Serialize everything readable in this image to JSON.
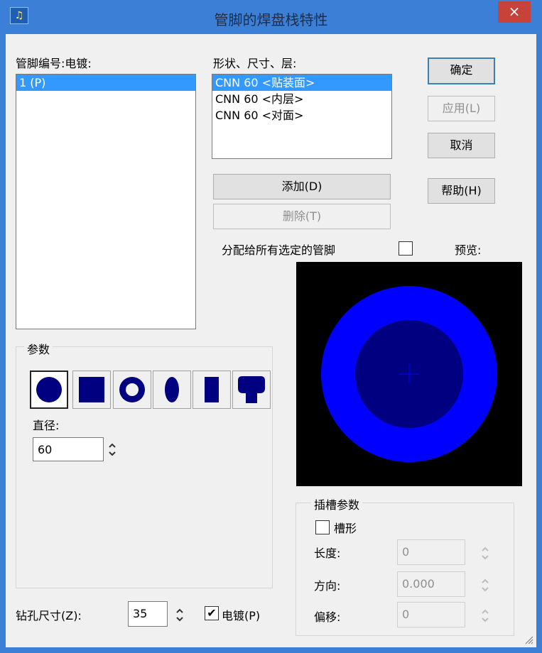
{
  "window": {
    "title": "管脚的焊盘栈特性",
    "icon": "app-icon",
    "close_symbol": "×"
  },
  "left": {
    "label": "管脚编号:电镀:",
    "items": [
      {
        "label": "1 (P)",
        "selected": true
      }
    ]
  },
  "layers": {
    "label": "形状、尺寸、层:",
    "items": [
      {
        "label": "CNN 60 <贴装面>",
        "selected": true
      },
      {
        "label": "CNN 60 <内层>",
        "selected": false
      },
      {
        "label": "CNN 60 <对面>",
        "selected": false
      }
    ]
  },
  "buttons": {
    "ok": "确定",
    "apply": "应用(L)",
    "cancel": "取消",
    "help": "帮助(H)",
    "add": "添加(D)",
    "delete": "删除(T)"
  },
  "assign": {
    "label": "分配给所有选定的管脚",
    "checked": false
  },
  "preview": {
    "label": "预览:",
    "colors": {
      "outer": "#0000ff",
      "inner": "#000080",
      "cross": "#0000ff"
    }
  },
  "params": {
    "title": "参数",
    "shapes": [
      "round",
      "square",
      "annular",
      "oval",
      "rectangle",
      "custom"
    ],
    "selected_shape": "round",
    "diameter_label": "直径:",
    "diameter_value": "60"
  },
  "slot": {
    "title": "插槽参数",
    "slot_label": "槽形",
    "slot_checked": false,
    "length_label": "长度:",
    "length_value": "0",
    "direction_label": "方向:",
    "direction_value": "0.000",
    "offset_label": "偏移:",
    "offset_value": "0"
  },
  "drill": {
    "label": "钻孔尺寸(Z):",
    "value": "35",
    "plated_label": "电镀(P)",
    "plated_checked": true
  }
}
